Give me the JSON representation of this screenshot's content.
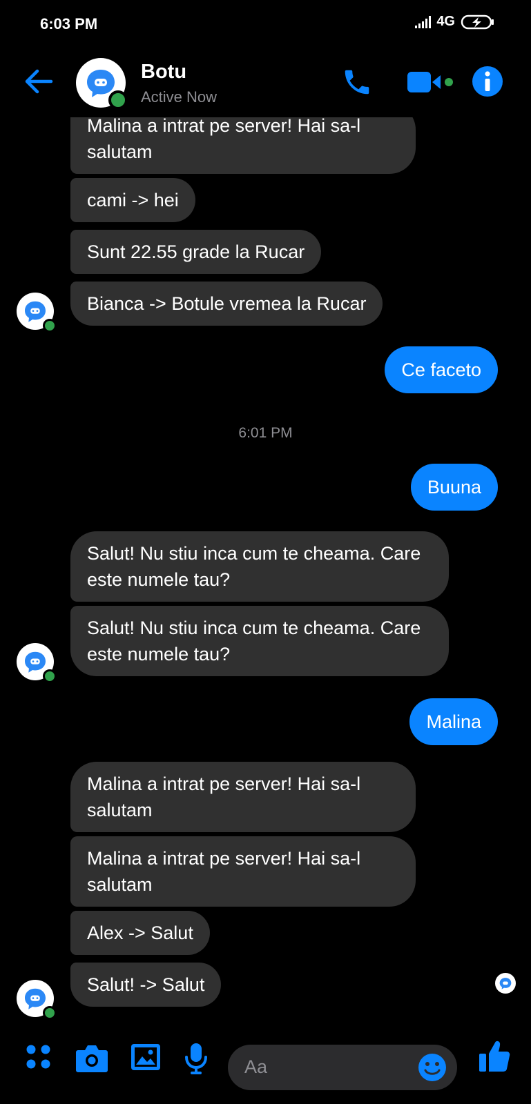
{
  "status_bar": {
    "time": "6:03 PM",
    "network": "4G"
  },
  "header": {
    "contact_name": "Botu",
    "contact_status": "Active Now"
  },
  "messages": [
    {
      "from": "bot",
      "text": "Malina a intrat pe server! Hai sa-l salutam"
    },
    {
      "from": "bot",
      "text": "cami -> hei"
    },
    {
      "from": "bot",
      "text": "Sunt 22.55 grade la Rucar"
    },
    {
      "from": "bot",
      "text": "Bianca -> Botule vremea la Rucar"
    },
    {
      "from": "me",
      "text": "Ce faceto"
    },
    {
      "from": "me",
      "text": "Buuna"
    },
    {
      "from": "bot",
      "text": "Salut! Nu stiu inca cum te cheama. Care este numele tau?"
    },
    {
      "from": "bot",
      "text": "Salut! Nu stiu inca cum te cheama. Care este numele tau?"
    },
    {
      "from": "me",
      "text": "Malina"
    },
    {
      "from": "bot",
      "text": "Malina a intrat pe server! Hai sa-l salutam"
    },
    {
      "from": "bot",
      "text": "Malina a intrat pe server! Hai sa-l salutam"
    },
    {
      "from": "bot",
      "text": "Alex -> Salut"
    },
    {
      "from": "bot",
      "text": "Salut! -> Salut"
    }
  ],
  "timestamp": "6:01 PM",
  "composer": {
    "placeholder": "Aa"
  },
  "colors": {
    "accent": "#0a84ff",
    "incoming_bubble": "#303030",
    "background": "#000000",
    "online": "#31a24c"
  },
  "icons": [
    "back-arrow-icon",
    "bot-avatar-icon",
    "phone-icon",
    "video-icon",
    "info-icon",
    "apps-grid-icon",
    "camera-icon",
    "gallery-icon",
    "microphone-icon",
    "emoji-icon",
    "thumbs-up-icon"
  ]
}
